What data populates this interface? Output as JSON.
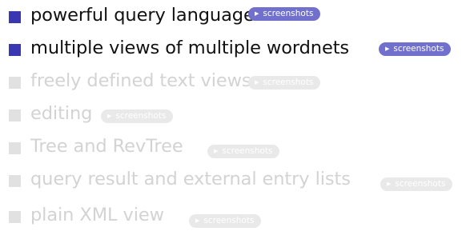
{
  "items": [
    {
      "label": "powerful query language",
      "button": "screenshots",
      "state": "active"
    },
    {
      "label": "multiple views of multiple wordnets",
      "button": "screenshots",
      "state": "active"
    },
    {
      "label": "freely defined text views",
      "button": "screenshots",
      "state": "dim"
    },
    {
      "label": "editing",
      "button": "screenshots",
      "state": "dim"
    },
    {
      "label": "Tree and RevTree",
      "button": "screenshots",
      "state": "dim"
    },
    {
      "label": "query result and external entry lists",
      "button": "screenshots",
      "state": "dim"
    },
    {
      "label": "plain XML view",
      "button": "screenshots",
      "state": "dim"
    }
  ],
  "icons": {
    "bullet": "square-bullet-icon",
    "button_glyph": "triangle-right-icon"
  },
  "colors": {
    "active_bullet": "#3a37b2",
    "active_button": "#7170cc",
    "active_text": "#111111",
    "dim_bullet": "#e1e1e1",
    "dim_button": "#e9e9ea",
    "dim_text": "#d3d3d3"
  }
}
